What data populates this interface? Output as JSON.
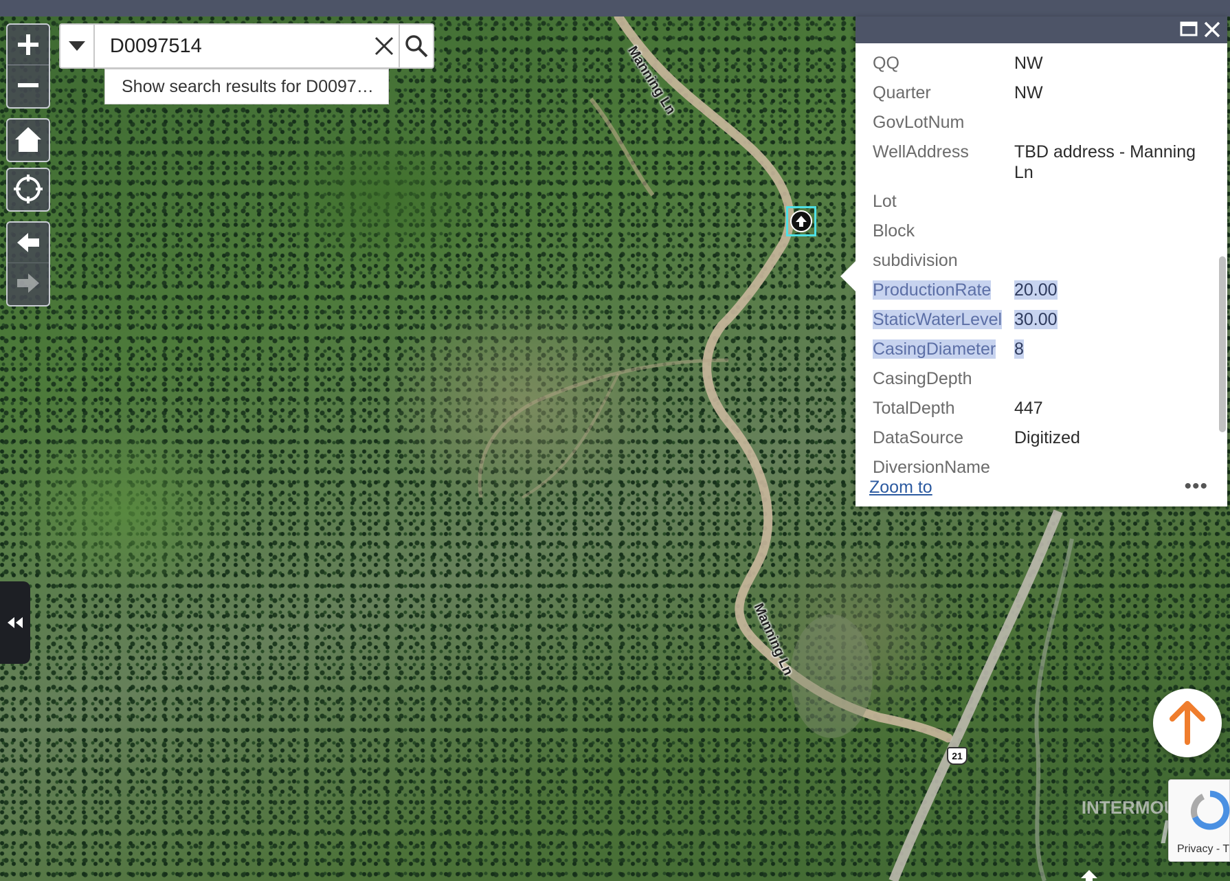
{
  "search": {
    "value": "D0097514",
    "suggestion": "Show search results for D0097…"
  },
  "map": {
    "road_labels": [
      "Manning Ln",
      "Manning Ln"
    ],
    "highway_shield": "21"
  },
  "popup": {
    "attributes": [
      {
        "key": "QQ",
        "value": "NW"
      },
      {
        "key": "Quarter",
        "value": "NW"
      },
      {
        "key": "GovLotNum",
        "value": ""
      },
      {
        "key": "WellAddress",
        "value": "TBD address - Manning Ln"
      },
      {
        "key": "Lot",
        "value": ""
      },
      {
        "key": "Block",
        "value": ""
      },
      {
        "key": "subdivision",
        "value": ""
      },
      {
        "key": "ProductionRate",
        "value": "20.00"
      },
      {
        "key": "StaticWaterLevel",
        "value": "30.00"
      },
      {
        "key": "CasingDiameter",
        "value": "8"
      },
      {
        "key": "CasingDepth",
        "value": ""
      },
      {
        "key": "TotalDepth",
        "value": "447"
      },
      {
        "key": "DataSource",
        "value": "Digitized"
      },
      {
        "key": "DiversionName",
        "value": ""
      }
    ],
    "zoom_to_label": "Zoom to",
    "more_label": "•••"
  },
  "watermark": {
    "line1": "INTERMOUNTAIN",
    "line2": "MLS"
  },
  "recaptcha": {
    "text": "Privacy - T"
  },
  "colors": {
    "header": "#4d5467",
    "highlight": "#c7d3ef",
    "marker_outline": "#4ee0e6",
    "to_top_arrow": "#ef7d2d",
    "link": "#2c5aa0"
  }
}
